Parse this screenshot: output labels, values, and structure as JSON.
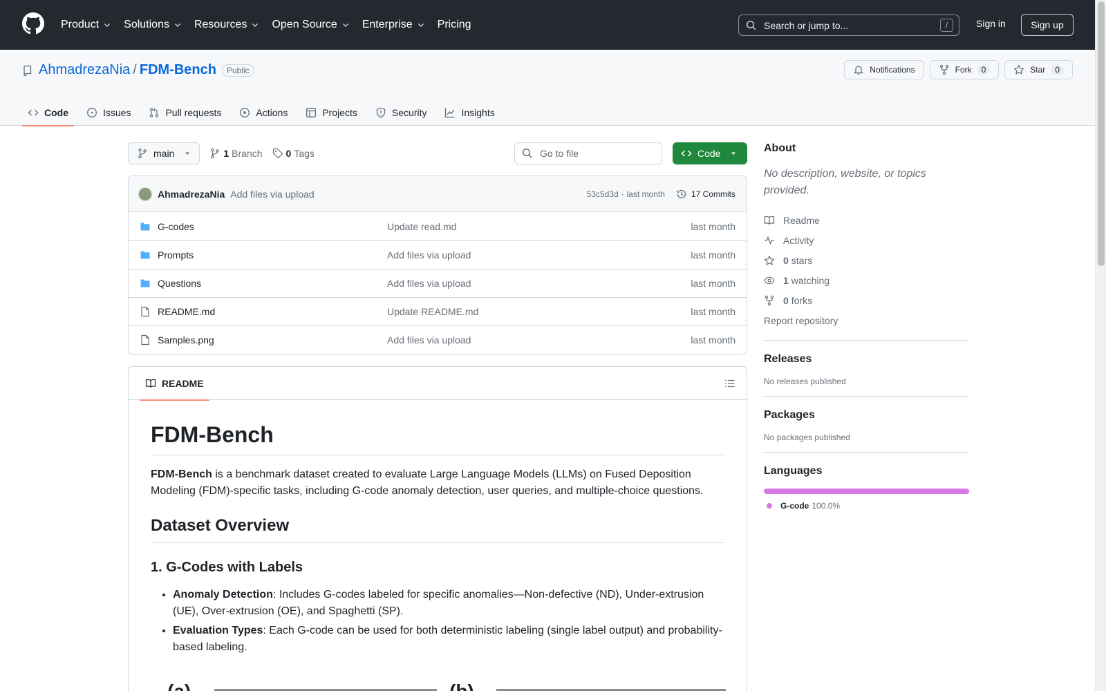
{
  "header": {
    "nav": [
      "Product",
      "Solutions",
      "Resources",
      "Open Source",
      "Enterprise",
      "Pricing"
    ],
    "search_placeholder": "Search or jump to...",
    "search_shortcut": "/",
    "signin": "Sign in",
    "signup": "Sign up"
  },
  "repo": {
    "owner": "AhmadrezaNia",
    "name": "FDM-Bench",
    "visibility": "Public",
    "notifications": "Notifications",
    "fork": "Fork",
    "fork_count": "0",
    "star": "Star",
    "star_count": "0",
    "tabs": [
      "Code",
      "Issues",
      "Pull requests",
      "Actions",
      "Projects",
      "Security",
      "Insights"
    ]
  },
  "toolbar": {
    "branch": "main",
    "branch_count": "1",
    "branch_label": "Branch",
    "tag_count": "0",
    "tag_label": "Tags",
    "go_to_file": "Go to file",
    "code": "Code"
  },
  "commit": {
    "author": "AhmadrezaNia",
    "message": "Add files via upload",
    "sha": "53c5d3d",
    "sep": "·",
    "time": "last month",
    "count": "17 Commits"
  },
  "files": [
    {
      "name": "G-codes",
      "type": "folder",
      "message": "Update read.md",
      "date": "last month"
    },
    {
      "name": "Prompts",
      "type": "folder",
      "message": "Add files via upload",
      "date": "last month"
    },
    {
      "name": "Questions",
      "type": "folder",
      "message": "Add files via upload",
      "date": "last month"
    },
    {
      "name": "README.md",
      "type": "file",
      "message": "Update README.md",
      "date": "last month"
    },
    {
      "name": "Samples.png",
      "type": "file",
      "message": "Add files via upload",
      "date": "last month"
    }
  ],
  "readme": {
    "tab": "README",
    "h1": "FDM-Bench",
    "intro_bold": "FDM-Bench",
    "intro_rest": " is a benchmark dataset created to evaluate Large Language Models (LLMs) on Fused Deposition Modeling (FDM)-specific tasks, including G-code anomaly detection, user queries, and multiple-choice questions.",
    "h2": "Dataset Overview",
    "h3": "1. G-Codes with Labels",
    "bullets": [
      {
        "bold": "Anomaly Detection",
        "text": ": Includes G-codes labeled for specific anomalies—Non-defective (ND), Under-extrusion (UE), Over-extrusion (OE), and Spaghetti (SP)."
      },
      {
        "bold": "Evaluation Types",
        "text": ": Each G-code can be used for both deterministic labeling (single label output) and probability-based labeling."
      }
    ],
    "fig_a": "(a)",
    "fig_b": "(b)"
  },
  "sidebar": {
    "about_title": "About",
    "about_desc": "No description, website, or topics provided.",
    "readme": "Readme",
    "activity": "Activity",
    "stars_count": "0",
    "stars": "stars",
    "watching_count": "1",
    "watching": "watching",
    "forks_count": "0",
    "forks": "forks",
    "report": "Report repository",
    "releases_title": "Releases",
    "releases_text": "No releases published",
    "packages_title": "Packages",
    "packages_text": "No packages published",
    "languages_title": "Languages",
    "language_name": "G-code",
    "language_pct": "100.0%",
    "language_color": "#d977e6"
  }
}
